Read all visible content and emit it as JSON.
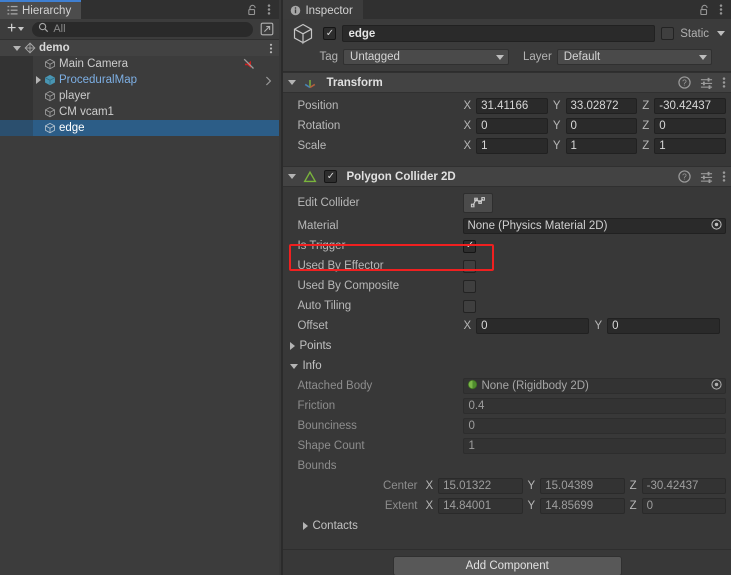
{
  "hierarchy": {
    "tab_label": "Hierarchy",
    "tab_icon": "hierarchy-icon",
    "lock_icon": "lock-open-icon",
    "menu_icon": "kebab-menu-icon",
    "toolbar": {
      "add_label": "+",
      "search_placeholder": "All",
      "search_value": "",
      "search_icon": "search-icon",
      "dock_icon": "open-in-window-icon"
    },
    "items": [
      {
        "label": "demo",
        "icon": "unity-scene-icon",
        "depth": 0,
        "expanded": true,
        "selected": false,
        "scene": true,
        "kebab": true
      },
      {
        "label": "Main Camera",
        "icon": "gameobject-cube-icon",
        "depth": 1,
        "expanded": null,
        "selected": false,
        "scene": false,
        "audio_mute": true
      },
      {
        "label": "ProceduralMap",
        "icon": "prefab-cube-icon",
        "depth": 1,
        "expanded": false,
        "selected": false,
        "scene": false,
        "prefab": true,
        "chevron": true
      },
      {
        "label": "player",
        "icon": "gameobject-cube-icon",
        "depth": 1,
        "expanded": null,
        "selected": false,
        "scene": false
      },
      {
        "label": "CM vcam1",
        "icon": "gameobject-cube-icon",
        "depth": 1,
        "expanded": null,
        "selected": false,
        "scene": false
      },
      {
        "label": "edge",
        "icon": "gameobject-cube-icon",
        "depth": 1,
        "expanded": null,
        "selected": true,
        "scene": false
      }
    ]
  },
  "inspector": {
    "tab_label": "Inspector",
    "tab_icon": "info-circle-icon",
    "lock_icon": "lock-open-icon",
    "menu_icon": "kebab-menu-icon",
    "object": {
      "icon": "gameobject-cube-icon",
      "enabled": true,
      "name": "edge",
      "name_placeholder": "Name",
      "static_checked": false,
      "static_label": "Static",
      "tag_label": "Tag",
      "tag_value": "Untagged",
      "layer_label": "Layer",
      "layer_value": "Default"
    },
    "transform": {
      "title": "Transform",
      "icon": "transform-axis-icon",
      "expanded": true,
      "help_icon": "help-icon",
      "preset_icon": "preset-sliders-icon",
      "menu_icon": "kebab-menu-icon",
      "rows": [
        {
          "label": "Position",
          "x": "31.41166",
          "y": "33.02872",
          "z": "-30.42437"
        },
        {
          "label": "Rotation",
          "x": "0",
          "y": "0",
          "z": "0"
        },
        {
          "label": "Scale",
          "x": "1",
          "y": "1",
          "z": "1"
        }
      ],
      "axis_labels": [
        "X",
        "Y",
        "Z"
      ]
    },
    "collider": {
      "title": "Polygon Collider 2D",
      "icon": "polygon-collider-2d-icon",
      "expanded": true,
      "enabled": true,
      "help_icon": "help-icon",
      "preset_icon": "preset-sliders-icon",
      "menu_icon": "kebab-menu-icon",
      "edit_collider_label": "Edit Collider",
      "edit_collider_icon": "edit-polygon-icon",
      "material_label": "Material",
      "material_value": "None (Physics Material 2D)",
      "material_picker_icon": "object-picker-icon",
      "is_trigger_label": "Is Trigger",
      "is_trigger_checked": true,
      "used_by_effector_label": "Used By Effector",
      "used_by_effector_checked": false,
      "used_by_composite_label": "Used By Composite",
      "used_by_composite_checked": false,
      "auto_tiling_label": "Auto Tiling",
      "auto_tiling_checked": false,
      "offset_label": "Offset",
      "offset_x": "0",
      "offset_y": "0",
      "points_label": "Points",
      "points_expanded": false,
      "info_label": "Info",
      "info_expanded": true,
      "info": {
        "attached_body_label": "Attached Body",
        "attached_body_value": "None (Rigidbody 2D)",
        "attached_body_icon": "rigidbody2d-icon",
        "attached_body_picker_icon": "object-picker-icon",
        "friction_label": "Friction",
        "friction_value": "0.4",
        "bounciness_label": "Bounciness",
        "bounciness_value": "0",
        "shape_count_label": "Shape Count",
        "shape_count_value": "1",
        "bounds_label": "Bounds",
        "center_label": "Center",
        "center_x": "15.01322",
        "center_y": "15.04389",
        "center_z": "-30.42437",
        "extent_label": "Extent",
        "extent_x": "14.84001",
        "extent_y": "14.85699",
        "extent_z": "0"
      },
      "contacts_label": "Contacts",
      "contacts_expanded": false
    },
    "add_component_label": "Add Component"
  },
  "annotation": {
    "highlight_color": "#f02020",
    "highlight_target": "Is Trigger"
  },
  "theme": {
    "window_bg": "#383838",
    "panel_bg": "#3c3c3c",
    "selection_blue": "#2c5d87",
    "active_tab_accent": "#3f7fd1",
    "prefab_blue": "#7dafe4",
    "collider_green": "#7ddc3a"
  }
}
